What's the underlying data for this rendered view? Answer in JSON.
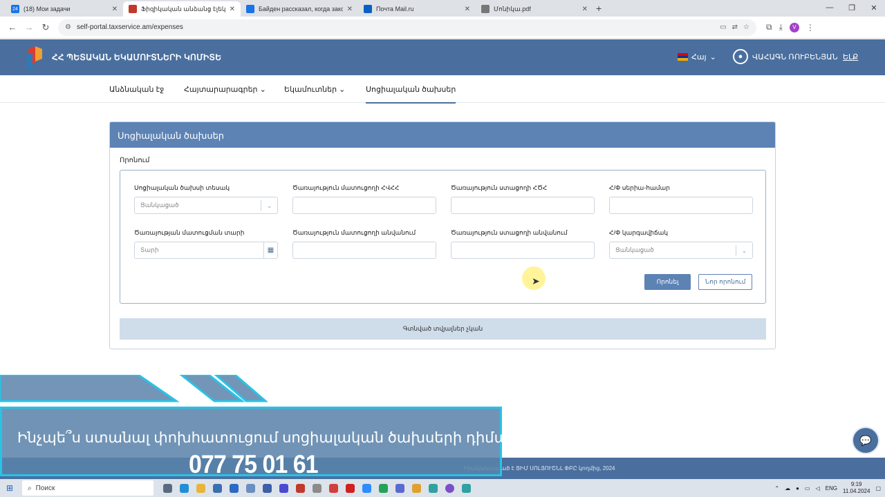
{
  "browser": {
    "tabs": [
      {
        "label": "(18) Мои задачи",
        "badge": "24",
        "color": "#1a73e8"
      },
      {
        "label": "Ֆիզիկական անձանց էլեկտ",
        "color": "#c0392b",
        "active": true
      },
      {
        "label": "Байден рассказал, когда закон",
        "color": "#1a73e8"
      },
      {
        "label": "Почта Mail.ru",
        "color": "#0a5fc4"
      },
      {
        "label": "Մոնիկա.pdf",
        "color": "#555555"
      }
    ],
    "url": "self-portal.taxservice.am/expenses",
    "profile_initial": "V"
  },
  "header": {
    "brand": "ՀՀ ՊԵՏԱԿԱՆ ԵԿԱՄՈՒՏՆԵՐԻ ԿՈՄԻՏԵ",
    "language": "Հայ",
    "user_name": "ՎԱՀԱԳՆ ՌՈՒԲԵՆՅԱՆ",
    "logout": "ԵԼՔ"
  },
  "menu": {
    "items": [
      {
        "label": "Անձնական էջ"
      },
      {
        "label": "Հայտարարագրեր",
        "chevron": true
      },
      {
        "label": "Եկամուտներ",
        "chevron": true
      },
      {
        "label": "Սոցիալական ծախսեր",
        "active": true
      }
    ]
  },
  "card": {
    "title": "Սոցիալական ծախսեր",
    "search_label": "Որոնում",
    "fields": [
      {
        "label": "Սոցիալական ծախսի տեսակ",
        "placeholder": "Ցանկացած",
        "type": "select"
      },
      {
        "label": "Ծառայություն մատուցողի ՀՎՀՀ",
        "placeholder": "",
        "type": "text"
      },
      {
        "label": "Ծառայություն ստացողի ՀԾՀ",
        "placeholder": "",
        "type": "text"
      },
      {
        "label": "Հ/Փ սերիա-համար",
        "placeholder": "",
        "type": "text"
      },
      {
        "label": "Ծառայության մատուցման տարի",
        "placeholder": "Տարի",
        "type": "date"
      },
      {
        "label": "Ծառայություն մատուցողի անվանում",
        "placeholder": "",
        "type": "text"
      },
      {
        "label": "Ծառայություն ստացողի անվանում",
        "placeholder": "",
        "type": "text"
      },
      {
        "label": "Հ/Փ կարգավիճակ",
        "placeholder": "Ցանկացած",
        "type": "select"
      }
    ],
    "search_button": "Որոնել",
    "new_search_button": "Նոր որոնում",
    "no_data": "Գտնված տվյալներ չկան"
  },
  "footer": {
    "text": "Իրականացված է ՑԻՄ ՍՈԼՅՈՒՇՆԼ ՓԲԸ կողմից, 2024"
  },
  "overlay": {
    "question": "Ինչպե՞ս ստանալ փոխհատուցում սոցիալական ծախսերի դիմաց:",
    "phone": "077 75 01 61"
  },
  "taskbar": {
    "search": "Поиск",
    "lang": "ENG",
    "time": "9:19",
    "date": "11.04.2024"
  }
}
